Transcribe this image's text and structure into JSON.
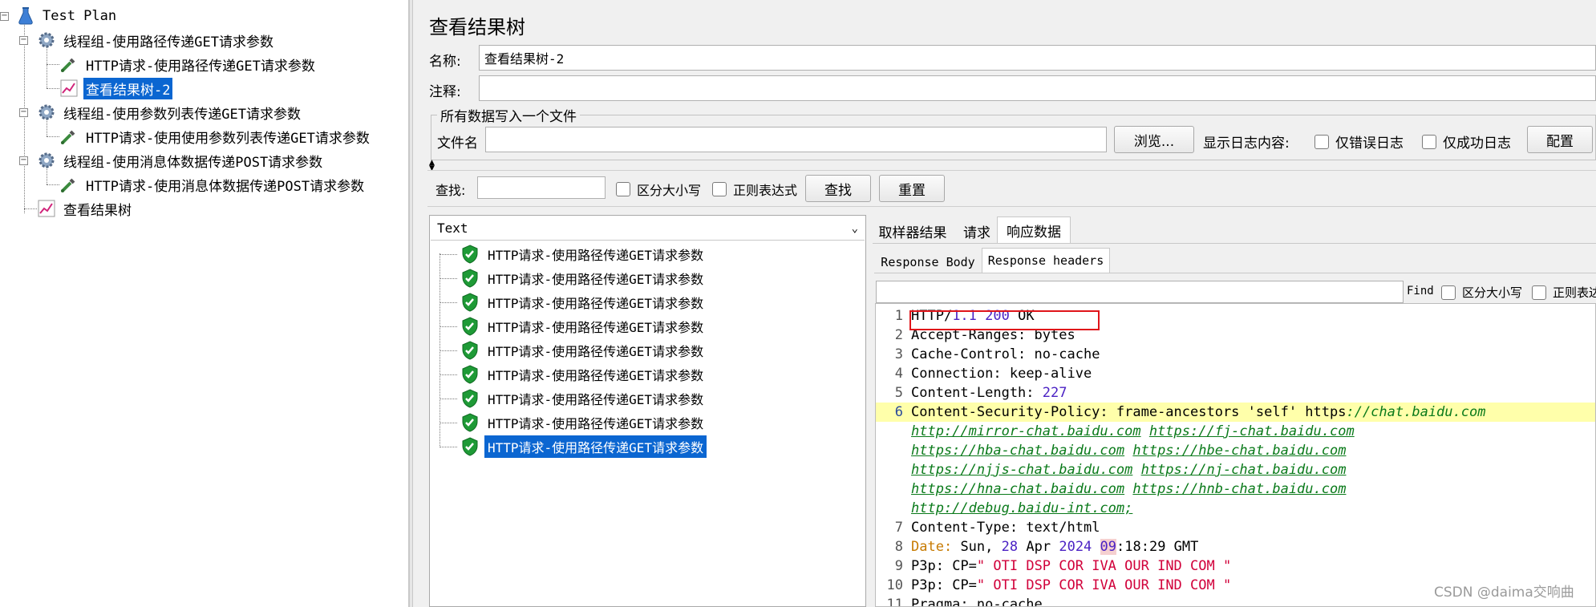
{
  "left_tree": {
    "root": "Test Plan",
    "items": [
      {
        "label": "线程组-使用路径传递GET请求参数",
        "level": 1,
        "icon": "gear-icon"
      },
      {
        "label": "HTTP请求-使用路径传递GET请求参数",
        "level": 2,
        "icon": "pipette-icon"
      },
      {
        "label": "查看结果树-2",
        "level": 2,
        "icon": "chart-icon",
        "selected": true
      },
      {
        "label": "线程组-使用参数列表传递GET请求参数",
        "level": 1,
        "icon": "gear-icon"
      },
      {
        "label": "HTTP请求-使用使用参数列表传递GET请求参数",
        "level": 2,
        "icon": "pipette-icon"
      },
      {
        "label": "线程组-使用消息体数据传递POST请求参数",
        "level": 1,
        "icon": "gear-icon"
      },
      {
        "label": "HTTP请求-使用消息体数据传递POST请求参数",
        "level": 2,
        "icon": "pipette-icon"
      },
      {
        "label": "查看结果树",
        "level": 1,
        "icon": "chart-icon"
      }
    ]
  },
  "panel": {
    "title": "查看结果树",
    "name_label": "名称:",
    "name_value": "查看结果树-2",
    "comment_label": "注释:",
    "comment_value": "",
    "file_group_title": "所有数据写入一个文件",
    "filename_label": "文件名",
    "filename_value": "",
    "browse_button": "浏览...",
    "log_label": "显示日志内容:",
    "errors_only": "仅错误日志",
    "success_only": "仅成功日志",
    "config_button": "配置"
  },
  "search": {
    "label": "查找:",
    "value": "",
    "case_sensitive": "区分大小写",
    "regex": "正则表达式",
    "find_button": "查找",
    "reset_button": "重置"
  },
  "renderer": {
    "selected": "Text"
  },
  "results": [
    {
      "label": "HTTP请求-使用路径传递GET请求参数"
    },
    {
      "label": "HTTP请求-使用路径传递GET请求参数"
    },
    {
      "label": "HTTP请求-使用路径传递GET请求参数"
    },
    {
      "label": "HTTP请求-使用路径传递GET请求参数"
    },
    {
      "label": "HTTP请求-使用路径传递GET请求参数"
    },
    {
      "label": "HTTP请求-使用路径传递GET请求参数"
    },
    {
      "label": "HTTP请求-使用路径传递GET请求参数"
    },
    {
      "label": "HTTP请求-使用路径传递GET请求参数"
    },
    {
      "label": "HTTP请求-使用路径传递GET请求参数",
      "selected": true
    }
  ],
  "detail_tabs": [
    "取样器结果",
    "请求",
    "响应数据"
  ],
  "detail_active_tab": "响应数据",
  "response_tabs": [
    "Response Body",
    "Response headers"
  ],
  "response_active_tab": "Response headers",
  "find_bar": {
    "label": "Find",
    "case_sensitive": "区分大小写",
    "regex": "正则表达"
  },
  "code": {
    "l1_proto": "HTTP/",
    "l1_ver": "1.1",
    "l1_status": "200",
    "l1_ok": "OK",
    "l2_key": "Accept-Ranges:",
    "l2_val": "bytes",
    "l3_key": "Cache-Control:",
    "l3_val": "no-cache",
    "l4_key": "Connection:",
    "l4_val": "keep-alive",
    "l5_key": "Content-Length:",
    "l5_val": "227",
    "l6_key": "Content-Security-Policy:",
    "l6_val": "frame-ancestors 'self' https",
    "l6_link0": "://chat.baidu.com",
    "l6_links": [
      "http://mirror-chat.baidu.com",
      "https://fj-chat.baidu.com",
      "https://hba-chat.baidu.com",
      "https://hbe-chat.baidu.com",
      "https://njjs-chat.baidu.com",
      "https://nj-chat.baidu.com",
      "https://hna-chat.baidu.com",
      "https://hnb-chat.baidu.com",
      "http://debug.baidu-int.com;"
    ],
    "l7_key": "Content-Type:",
    "l7_val": "text/html",
    "l8_key": "Date:",
    "l8_day": "Sun,",
    "l8_num": "28",
    "l8_mon": "Apr",
    "l8_year": "2024",
    "l8_hour": "09",
    "l8_rest": ":18:29 GMT",
    "l9_key": "P3p:",
    "l9_cp": "CP=",
    "l9_val": "\" OTI DSP COR IVA OUR IND COM \"",
    "l10_key": "P3p:",
    "l10_cp": "CP=",
    "l10_val": "\" OTI DSP COR IVA OUR IND COM \"",
    "l11_text": "Pragma: no-cache",
    "line_numbers": [
      "1",
      "2",
      "3",
      "4",
      "5",
      "6",
      "7",
      "8",
      "9",
      "10",
      "11"
    ]
  },
  "watermark": "CSDN @daima交响曲"
}
